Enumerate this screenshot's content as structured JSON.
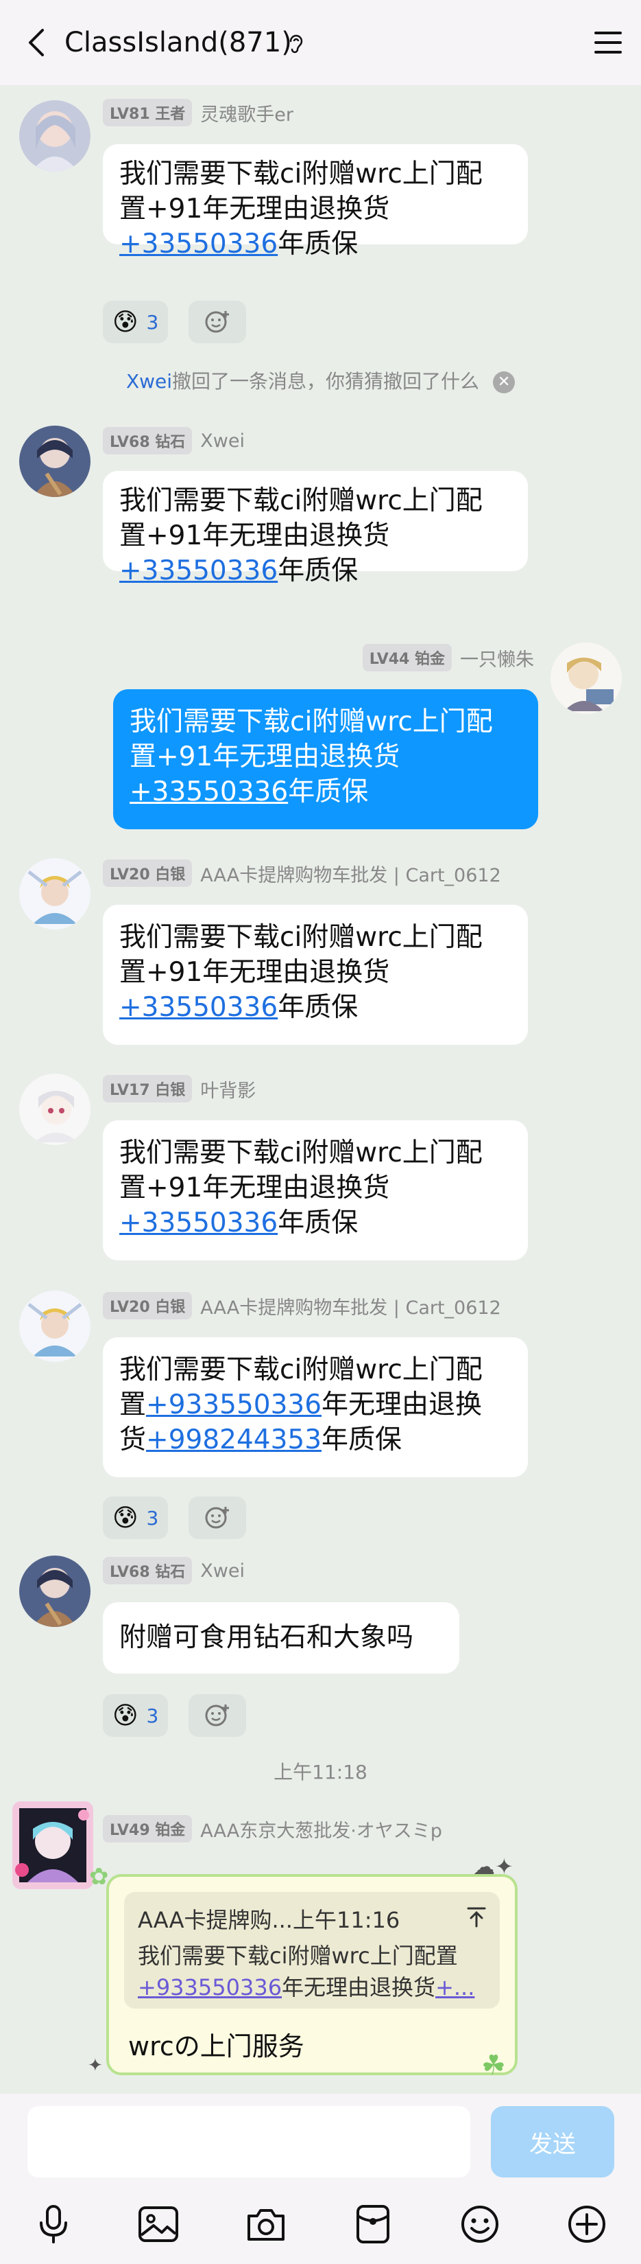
{
  "header": {
    "title": "ClassIsland(871)"
  },
  "messages": [
    {
      "level": "LV81 王者",
      "name": "灵魂歌手er",
      "line1": "我们需要下载ci附赠wrc上门配",
      "line2": "置+91年无理由退换货",
      "phone": "+33550336",
      "tail": "年质保",
      "reaction_count": "3"
    },
    {
      "level": "LV68 钻石",
      "name": "Xwei",
      "line1": "我们需要下载ci附赠wrc上门配",
      "line2": "置+91年无理由退换货",
      "phone": "+33550336",
      "tail": "年质保"
    },
    {
      "level": "LV44 铂金",
      "name": "一只懒朱",
      "line1": "我们需要下载ci附赠wrc上门配",
      "line2": "置+91年无理由退换货",
      "phone": "+33550336",
      "tail": "年质保"
    },
    {
      "level": "LV20 白银",
      "name": "AAA卡提牌购物车批发 | Cart_0612",
      "line1": "我们需要下载ci附赠wrc上门配",
      "line2": "置+91年无理由退换货",
      "phone": "+33550336",
      "tail": "年质保"
    },
    {
      "level": "LV17 白银",
      "name": "叶背影",
      "line1": "我们需要下载ci附赠wrc上门配",
      "line2": "置+91年无理由退换货",
      "phone": "+33550336",
      "tail": "年质保"
    },
    {
      "level": "LV20 白银",
      "name": "AAA卡提牌购物车批发 | Cart_0612",
      "line1": "我们需要下载ci附赠wrc上门配",
      "l2a": "置",
      "phone1": "+933550336",
      "l2b": "年无理由退换",
      "l3a": "货",
      "phone2": "+998244353",
      "l3b": "年质保",
      "reaction_count": "3"
    },
    {
      "level": "LV68 钻石",
      "name": "Xwei",
      "text": "附赠可食用钻石和大象吗",
      "reaction_count": "3"
    },
    {
      "level": "LV49 铂金",
      "name": "AAA东京大葱批发·オヤスミp",
      "quote_head": "AAA卡提牌购...上午11:16",
      "quote_line1": "我们需要下载ci附赠wrc上门配置",
      "quote_phone": "+933550336",
      "quote_mid": "年无理由退换货",
      "quote_tail": "+...",
      "reply": "wrcの上门服务"
    }
  ],
  "recall": {
    "who": "Xwei",
    "text": "撤回了一条消息，你猜猜撤回了什么"
  },
  "timestamp": "上午11:18",
  "bottom": {
    "send_label": "发送"
  }
}
